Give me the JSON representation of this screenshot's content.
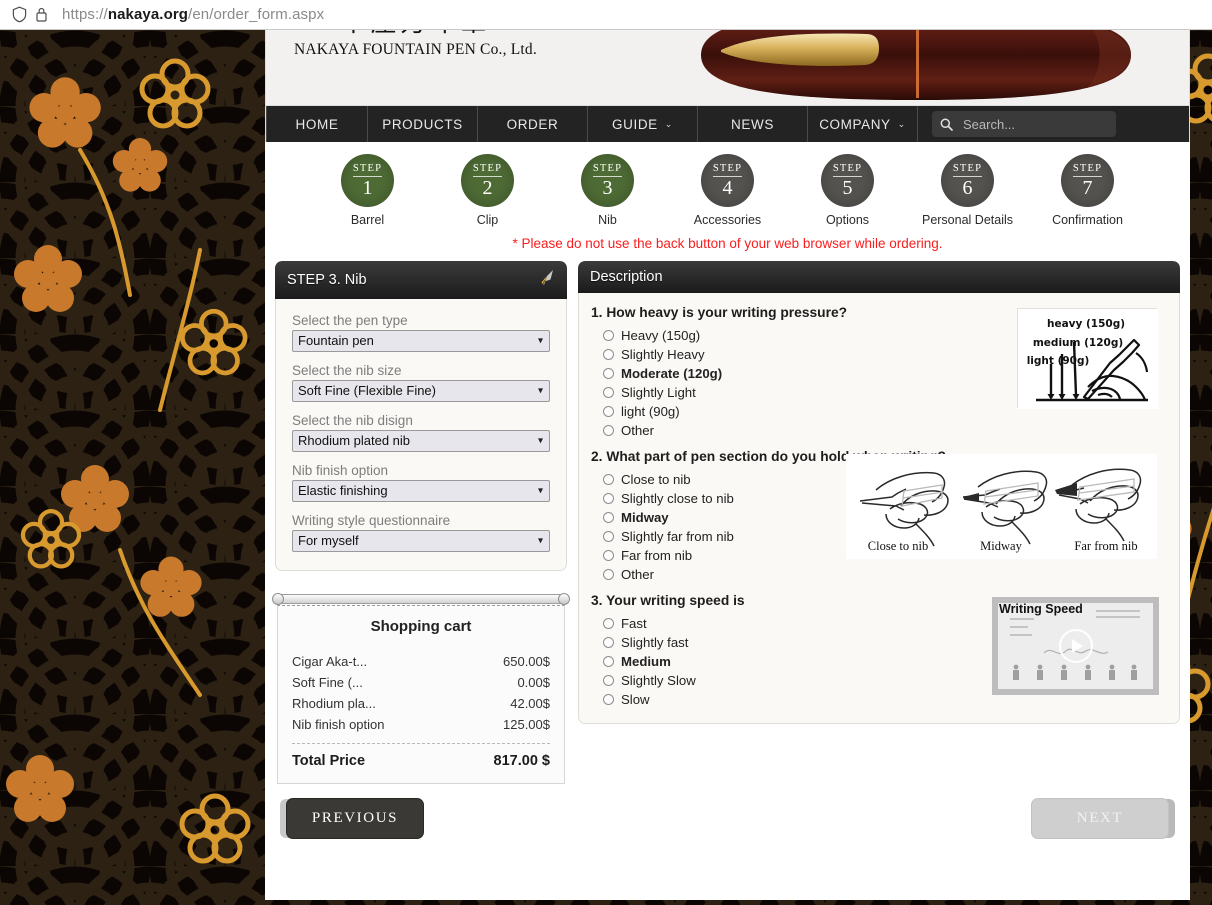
{
  "browser": {
    "url_prefix": "https://",
    "url_host": "nakaya.org",
    "url_path": "/en/order_form.aspx",
    "shield_icon": "shield-icon",
    "lock_icon": "lock-icon"
  },
  "site": {
    "logo_mark": "中屋万年筆",
    "logo_text": "NAKAYA FOUNTAIN PEN Co., Ltd."
  },
  "nav": {
    "items": [
      {
        "label": "HOME",
        "caret": ""
      },
      {
        "label": "PRODUCTS",
        "caret": ""
      },
      {
        "label": "ORDER",
        "caret": ""
      },
      {
        "label": "GUIDE",
        "caret": "⌄"
      },
      {
        "label": "NEWS",
        "caret": ""
      },
      {
        "label": "COMPANY",
        "caret": "⌄"
      }
    ],
    "search_placeholder": "Search...",
    "search_value": ""
  },
  "steps": [
    {
      "word": "STEP",
      "num": "1",
      "label": "Barrel",
      "state": "done"
    },
    {
      "word": "STEP",
      "num": "2",
      "label": "Clip",
      "state": "done"
    },
    {
      "word": "STEP",
      "num": "3",
      "label": "Nib",
      "state": "done"
    },
    {
      "word": "STEP",
      "num": "4",
      "label": "Accessories",
      "state": "todo"
    },
    {
      "word": "STEP",
      "num": "5",
      "label": "Options",
      "state": "todo"
    },
    {
      "word": "STEP",
      "num": "6",
      "label": "Personal Details",
      "state": "todo"
    },
    {
      "word": "STEP",
      "num": "7",
      "label": "Confirmation",
      "state": "todo"
    }
  ],
  "warning": "* Please do not use the back button of your web browser while ordering.",
  "left_panel": {
    "title": "STEP 3. Nib",
    "header_icon": "nib-icon",
    "fields": [
      {
        "label": "Select the pen type",
        "value": "Fountain pen"
      },
      {
        "label": "Select the nib size",
        "value": "Soft Fine (Flexible Fine)"
      },
      {
        "label": "Select the nib disign",
        "value": "Rhodium plated nib"
      },
      {
        "label": "Nib finish option",
        "value": "Elastic finishing"
      },
      {
        "label": "Writing style questionnaire",
        "value": "For myself"
      }
    ]
  },
  "cart": {
    "title": "Shopping cart",
    "rows": [
      {
        "name": "Cigar Aka-t...",
        "price": "650.00$"
      },
      {
        "name": "Soft Fine (...",
        "price": "0.00$"
      },
      {
        "name": "Rhodium pla...",
        "price": "42.00$"
      },
      {
        "name": "Nib finish option",
        "price": "125.00$"
      }
    ],
    "total_label": "Total Price",
    "total_value": "817.00 $"
  },
  "right_panel": {
    "title": "Description",
    "questions": [
      {
        "text": "1. How heavy is your writing pressure?",
        "options": [
          {
            "label": "Heavy (150g)",
            "bold": false,
            "selected": false
          },
          {
            "label": "Slightly Heavy",
            "bold": false,
            "selected": false
          },
          {
            "label": "Moderate (120g)",
            "bold": true,
            "selected": false
          },
          {
            "label": "Slightly Light",
            "bold": false,
            "selected": false
          },
          {
            "label": "light (90g)",
            "bold": false,
            "selected": false
          },
          {
            "label": "Other",
            "bold": false,
            "selected": false
          }
        ],
        "illustration": {
          "type": "pressure-diagram",
          "captions": [
            "heavy (150g)",
            "medium (120g)",
            "light (90g)"
          ]
        }
      },
      {
        "text": "2. What part of pen section do you hold when writing?",
        "options": [
          {
            "label": "Close to nib",
            "bold": false,
            "selected": false
          },
          {
            "label": "Slightly close to nib",
            "bold": false,
            "selected": false
          },
          {
            "label": "Midway",
            "bold": true,
            "selected": false
          },
          {
            "label": "Slightly far from nib",
            "bold": false,
            "selected": false
          },
          {
            "label": "Far from nib",
            "bold": false,
            "selected": false
          },
          {
            "label": "Other",
            "bold": false,
            "selected": false
          }
        ],
        "illustration": {
          "type": "hand-grip-diagram",
          "captions": [
            "Close to nib",
            "Midway",
            "Far from nib"
          ]
        }
      },
      {
        "text": "3. Your writing speed is",
        "options": [
          {
            "label": "Fast",
            "bold": false,
            "selected": false
          },
          {
            "label": "Slightly fast",
            "bold": false,
            "selected": false
          },
          {
            "label": "Medium",
            "bold": true,
            "selected": false
          },
          {
            "label": "Slightly Slow",
            "bold": false,
            "selected": false
          },
          {
            "label": "Slow",
            "bold": false,
            "selected": false
          }
        ],
        "illustration": {
          "type": "video-thumbnail",
          "title": "Writing Speed",
          "play_icon": "play-button-icon"
        }
      }
    ]
  },
  "footer": {
    "previous_label": "PREVIOUS",
    "next_label": "NEXT",
    "next_disabled": true
  },
  "colors": {
    "step_done": "#4e6b35",
    "step_todo": "#555350",
    "warning_text": "#fa1d1d",
    "nav_bg": "#232323",
    "panel_head": "#1b1b1b",
    "pattern_gold": "#d08a2a",
    "pattern_bg": "#0b0603"
  }
}
